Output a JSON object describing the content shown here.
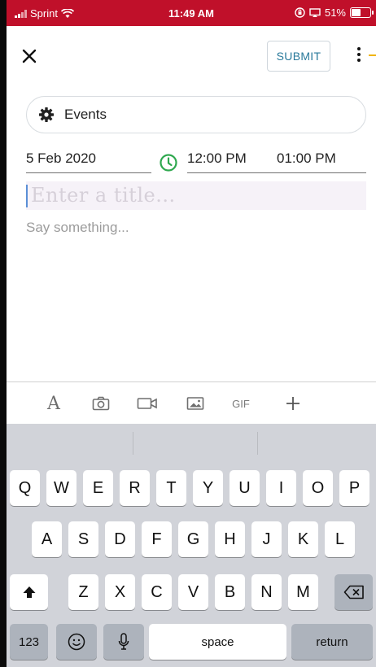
{
  "status_bar": {
    "carrier": "Sprint",
    "time": "11:49 AM",
    "battery": "51%",
    "battery_level": 0.51
  },
  "header": {
    "submit_label": "SUBMIT"
  },
  "category": {
    "label": "Events"
  },
  "schedule": {
    "date": "5 Feb 2020",
    "start_time": "12:00 PM",
    "end_time": "01:00 PM"
  },
  "post": {
    "title_placeholder": "Enter a title...",
    "body_placeholder": "Say something..."
  },
  "toolbar": {
    "items": [
      "text-format-icon",
      "camera-icon",
      "video-icon",
      "image-icon",
      "gif",
      "plus-icon"
    ],
    "gif_label": "GIF"
  },
  "keyboard": {
    "row1": [
      "Q",
      "W",
      "E",
      "R",
      "T",
      "Y",
      "U",
      "I",
      "O",
      "P"
    ],
    "row2": [
      "A",
      "S",
      "D",
      "F",
      "G",
      "H",
      "J",
      "K",
      "L"
    ],
    "row3": [
      "Z",
      "X",
      "C",
      "V",
      "B",
      "N",
      "M"
    ],
    "numbers_label": "123",
    "space_label": "space",
    "return_label": "return"
  },
  "colors": {
    "status_bar": "#c0102a",
    "accent_blue": "#2a7a9b",
    "clock_green": "#2fa84f",
    "keyboard_bg": "#d1d3d9"
  }
}
